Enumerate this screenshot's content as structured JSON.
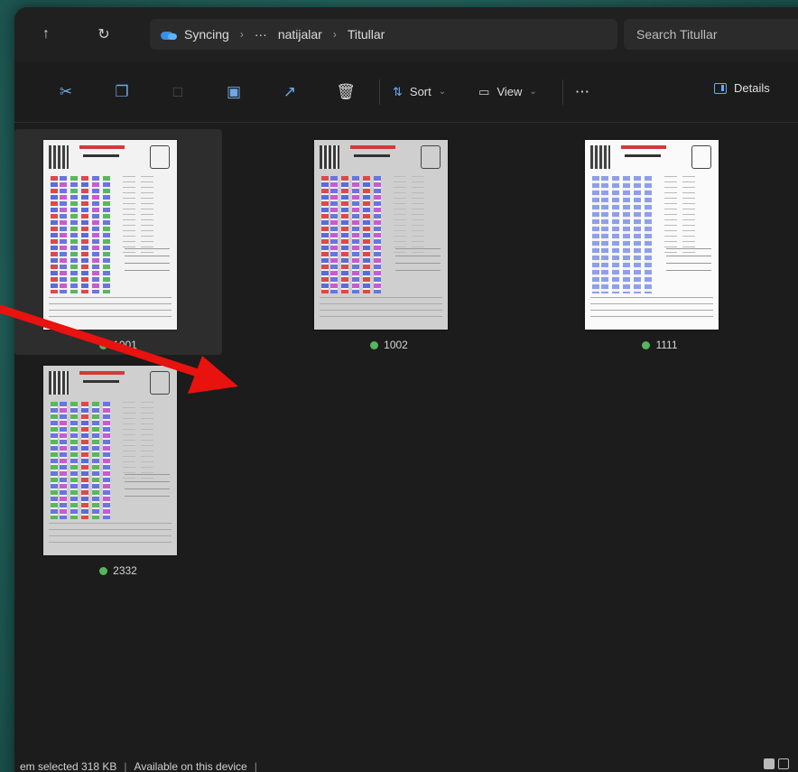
{
  "addressbar": {
    "back_icon": "up-arrow-icon",
    "refresh_icon": "refresh-icon",
    "crumbs": [
      "Syncing",
      "···",
      "natijalar",
      "Titullar"
    ],
    "search_placeholder": "Search Titullar"
  },
  "toolbar": {
    "sort_label": "Sort",
    "view_label": "View",
    "more_label": "···",
    "details_label": "Details"
  },
  "files": [
    {
      "name": "1001",
      "selected": true
    },
    {
      "name": "1002",
      "selected": false
    },
    {
      "name": "1111",
      "selected": false
    },
    {
      "name": "2332",
      "selected": false
    }
  ],
  "status": {
    "selection": "em selected  318 KB",
    "availability": "Available on this device"
  },
  "colors": {
    "sync_status": "#55b65a",
    "accent": "#6fa8e8",
    "annotation_arrow": "#e8120f"
  }
}
